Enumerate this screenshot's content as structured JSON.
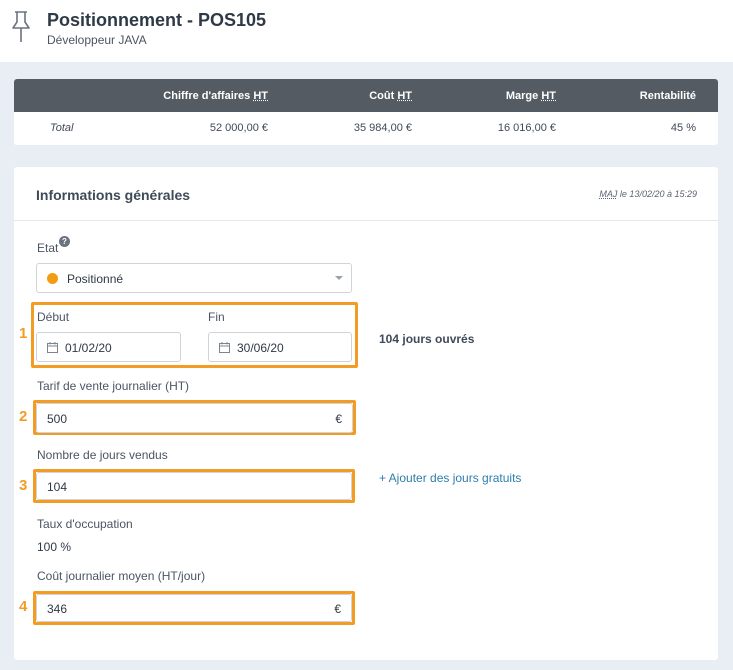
{
  "header": {
    "title": "Positionnement - POS105",
    "subtitle": "Développeur JAVA",
    "icon": "pin-icon"
  },
  "summary": {
    "columns": [
      "Chiffre d'affaires",
      "Coût",
      "Marge",
      "Rentabilité"
    ],
    "suffix": "HT",
    "row_label": "Total",
    "values": [
      "52 000,00 €",
      "35 984,00 €",
      "16 016,00 €",
      "45 %"
    ]
  },
  "card": {
    "title": "Informations générales",
    "updated_prefix": "MAJ",
    "updated_rest": "le 13/02/20 à 15:29"
  },
  "etat": {
    "label": "Etat",
    "help_icon": "?",
    "value": "Positionné",
    "status_color": "#f39c12"
  },
  "dates": {
    "start_label": "Début",
    "start_value": "01/02/20",
    "end_label": "Fin",
    "end_value": "30/06/20",
    "working_days": "104 jours ouvrés"
  },
  "tarif": {
    "label": "Tarif de vente journalier (HT)",
    "value": "500",
    "suffix": "€"
  },
  "jours": {
    "label": "Nombre de jours vendus",
    "value": "104",
    "add_free_days": "+ Ajouter des jours gratuits"
  },
  "occupation": {
    "label": "Taux d'occupation",
    "value": "100 %"
  },
  "cout": {
    "label": "Coût journalier moyen (HT/jour)",
    "value": "346",
    "suffix": "€"
  },
  "markers": [
    "1",
    "2",
    "3",
    "4"
  ],
  "colors": {
    "highlight": "#f39c24",
    "table_header": "#555b63",
    "link": "#2e7dab"
  }
}
